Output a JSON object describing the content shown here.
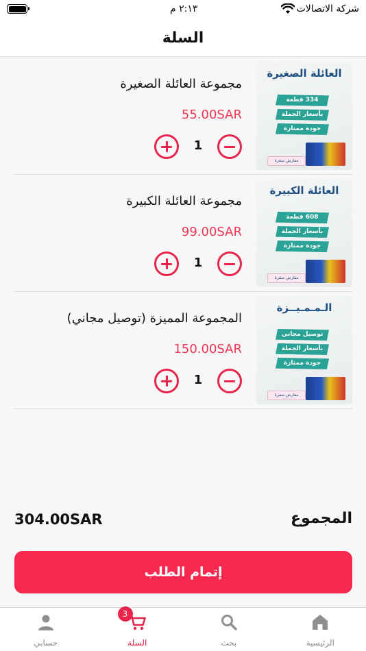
{
  "status_bar": {
    "carrier": "شركة الاتصالات",
    "time": "٢:١٣ م"
  },
  "header": {
    "title": "السلة"
  },
  "cart": {
    "items": [
      {
        "name": "مجموعة العائلة الصغيرة",
        "price": "55.00SAR",
        "quantity": "1",
        "image": {
          "title": "العائلة الصغيرة",
          "tags": [
            "334 قطعة",
            "بأسعار الجملة",
            "جودة ممتازة"
          ],
          "small_box_text": "مفارش سفرة"
        }
      },
      {
        "name": "مجموعة العائلة الكبيرة",
        "price": "99.00SAR",
        "quantity": "1",
        "image": {
          "title": "العائلة الكبيرة",
          "tags": [
            "608 قطعة",
            "بأسعار الجملة",
            "جودة ممتازة"
          ],
          "small_box_text": "مفارش سفرة"
        }
      },
      {
        "name": "المجموعة المميزة (توصيل مجاني)",
        "price": "150.00SAR",
        "quantity": "1",
        "image": {
          "title": "الـمـمـيــزة",
          "tags": [
            "توصيل مجاني",
            "بأسعار الجملة",
            "جودة ممتازة"
          ],
          "small_box_text": "مفارش سفرة"
        }
      }
    ]
  },
  "total": {
    "label": "المجموع",
    "value": "304.00SAR"
  },
  "checkout": {
    "label": "إتمام الطلب"
  },
  "tab_bar": {
    "tabs": [
      {
        "label": "حسابي",
        "icon": "person-icon"
      },
      {
        "label": "السلة",
        "icon": "cart-icon",
        "badge": "3"
      },
      {
        "label": "بحث",
        "icon": "search-icon"
      },
      {
        "label": "الرئيسية",
        "icon": "home-icon"
      }
    ]
  },
  "colors": {
    "accent": "#e8244c",
    "checkout_button": "#f92851",
    "price": "#f03455",
    "tag": "#2aa396",
    "image_title": "#1e4f80"
  }
}
